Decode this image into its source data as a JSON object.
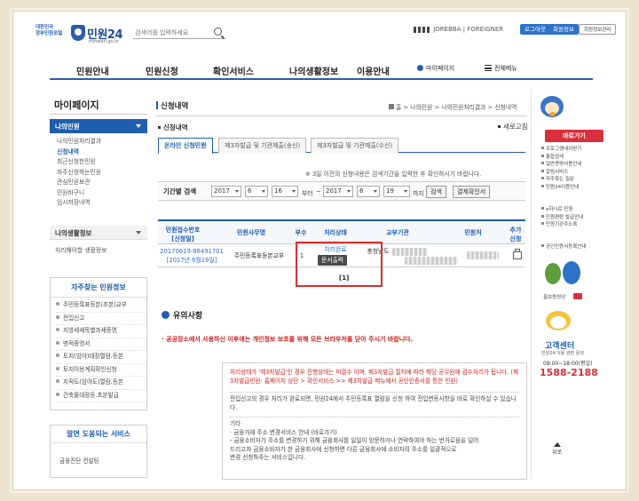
{
  "header": {
    "logo_small": "대한민국\n정부민원포털",
    "logo_title": "민원24",
    "logo_url": "minwon.go.kr",
    "search_placeholder": "검색어를 입력하세요",
    "util_text": "JOREBBA | FOREIGNER",
    "login_label": "로그아웃",
    "join_label": "회원정보",
    "member_label": "회원정보관리"
  },
  "gnb": {
    "items": [
      "민원안내",
      "민원신청",
      "확인서비스",
      "나의생활정보",
      "이용안내"
    ],
    "mypage_label": "마이페이지",
    "allmenu_label": "전체메뉴"
  },
  "sidebar": {
    "title": "마이페이지",
    "active_section": "나의민원",
    "items": [
      "나의민원처리결과",
      "신청내역",
      "최근신청한민원",
      "자주신청하는민원",
      "관심민원보관",
      "민원바구니",
      "임시저장내역"
    ],
    "section2": "나의생활정보",
    "section2_item": "처리해야할 생활정보",
    "faq_title": "자주찾는 민원정보",
    "faq_items": [
      "주민등록표등본(초본)교부",
      "전입신고",
      "지방세세목별과세증명",
      "병적증명서",
      "토지(임야)대장열람.등본",
      "토지이용계획확인신청",
      "지적도(임야도)열람.등본",
      "건축물대장등.초본발급"
    ],
    "useful_title": "알면 도움되는 서비스",
    "useful_item": "금융진단 컨설팅"
  },
  "main": {
    "title": "신청내역",
    "breadcrumb": [
      "홈",
      "나의민원",
      "나의민원처리결과",
      "신청내역"
    ],
    "subtitle": "신청내역",
    "refresh_label": "새로고침",
    "tabs": [
      "온라인 신청민원",
      "제3자발급 및 기관제출(송신)",
      "제3자발급 및 기관제출(수신)"
    ],
    "notice_line": "※ 3일 이전의 신청내용은 검색기간을 입력한 후 확인하시기 바랍니다.",
    "search": {
      "period_label": "기간별 검색",
      "from_year": "2017",
      "from_month": "6",
      "from_day": "16",
      "from_suffix": "부터",
      "dash": "~",
      "to_year": "2017",
      "to_month": "6",
      "to_day": "19",
      "to_suffix": "까지",
      "search_btn": "검색",
      "print_btn": "결제확인서"
    },
    "table": {
      "headers": [
        "민원접수번호\n[신청일]",
        "민원사무명",
        "부수",
        "처리상태",
        "교부기관",
        "민원처",
        "추가\n신청"
      ],
      "row": {
        "receipt_no": "20170619-88491701",
        "date": "[2017년 6월19일]",
        "service": "주민등록표등본교부",
        "copies": "1",
        "status": "처리완료",
        "print_label": "문서출력",
        "agency": "충청남도"
      },
      "pager": "[1]"
    },
    "caution": {
      "title": "유의사항",
      "red_notice": "· 공공장소에서 사용하신 이후에는 개인정보 보호를 위해 모든 브라우저를 닫아 주시기 바랍니다.",
      "items": [
        "처리상태가 '제3자발급'인 경우 진행상태는 미결수 이며, 제3자발급 절차에 따라 해당 공무원에 검수처리가 됩니다. (제3자발급민원: 홈페이지 상단 > 확인서비스 >> 제3자발급 메뉴에서 공인인증서를 통한 민원)",
        "전입신고의 경우 처리가 완료되면, 민원24에서 주민등록표 열람을 신청 하여 전입변동사항을 바로 확인하실 수 있습니다.",
        "기타\n· 금융거래 주소 변경서비스 안내 (바로가기)\n - 금융소비자가 주소를 변경하기 위해 금융회사를 일일이 방문하거나 연락하여야 하는 번거로움을 덜어\n드리고자 금융소비자가 한 금융회사에 신청하면 다른 금융회사에 소비자의 주소를 일괄적으로\n변경 신청하주는 서비스입니다."
      ]
    }
  },
  "right": {
    "badge": "바로가기",
    "list1": [
      "프로그램내려받기",
      "통합검색",
      "일반증명사용안내",
      "알림서비스",
      "자주찾는 질문",
      "민원24이용안내"
    ],
    "list2": [
      "e하나로 민원",
      "민원편람 발급안내",
      "민원기관주소록"
    ],
    "list3": [
      "공인인증서등록안내"
    ],
    "banner_label": "홍보동영상",
    "center_title": "고객센터",
    "center_sub": "민원24 이용 관련 문의",
    "hours": "09:00~18:00(평일)",
    "phone": "1588-2188",
    "top_label": "위로"
  },
  "colors": {
    "primary": "#1f5dae",
    "accent_red": "#d63030",
    "link": "#2d73c9"
  }
}
